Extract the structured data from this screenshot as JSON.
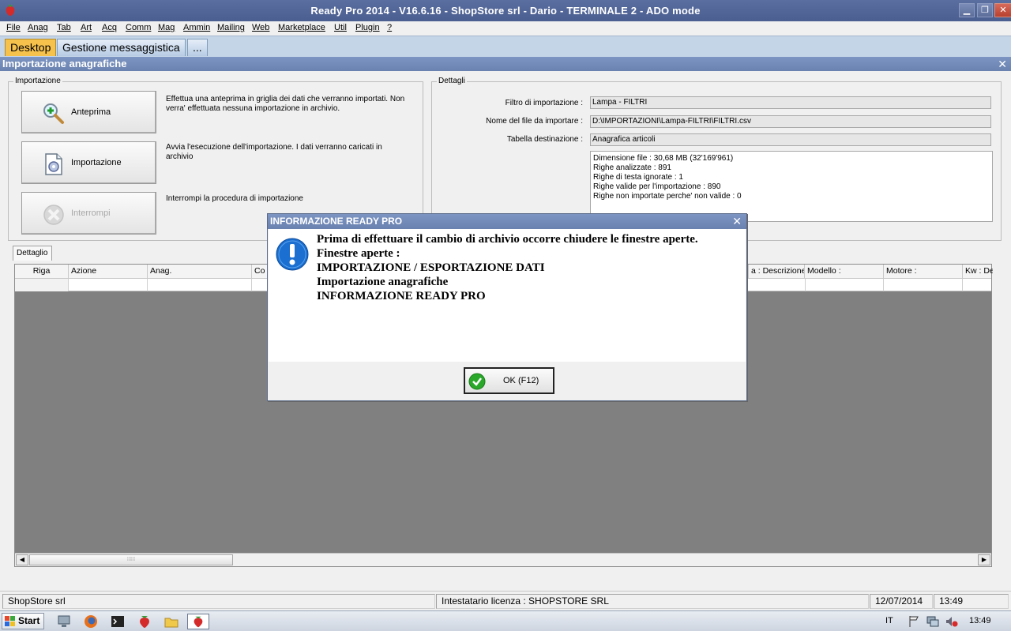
{
  "window": {
    "title": "Ready Pro 2014 - V16.6.16 - ShopStore srl - Dario - TERMINALE 2 - ADO mode",
    "icon": "strawberry-icon"
  },
  "menu": [
    "File",
    "Anag",
    "Tab",
    "Art",
    "Acq",
    "Comm",
    "Mag",
    "Ammin",
    "Mailing",
    "Web",
    "Marketplace",
    "Util",
    "Plugin",
    "?"
  ],
  "tabs": [
    "Desktop",
    "Gestione messaggistica",
    "..."
  ],
  "subwindow": {
    "title": "Importazione anagrafiche"
  },
  "import_group": {
    "legend": "Importazione",
    "buttons": [
      {
        "label": "Anteprima",
        "icon": "magnifier-plus-icon",
        "desc": "Effettua una anteprima in griglia dei dati che verranno importati. Non verra' effettuata nessuna importazione in archivio."
      },
      {
        "label": "Importazione",
        "icon": "document-gear-icon",
        "desc": "Avvia l'esecuzione dell'importazione. I dati verranno caricati in archivio"
      },
      {
        "label": "Interrompi",
        "icon": "stop-x-icon",
        "desc": "Interrompi la procedura di importazione"
      }
    ]
  },
  "details_group": {
    "legend": "Dettagli",
    "filter_label": "Filtro di importazione :",
    "filter_value": "Lampa - FILTRI",
    "file_label": "Nome del file da importare :",
    "file_value": "D:\\IMPORTAZIONI\\Lampa-FILTRI\\FILTRI.csv",
    "table_label": "Tabella destinazione :",
    "table_value": "Anagrafica articoli",
    "info_lines": [
      "Dimensione file : 30,68 MB (32'169'961)",
      "Righe analizzate : 891",
      "Righe di testa ignorate : 1",
      "Righe valide per l'importazione : 890",
      "Righe non importate perche' non valide : 0"
    ]
  },
  "detail_tab": "Dettaglio",
  "grid": {
    "columns_left": [
      "Riga",
      "Azione",
      "Anag.",
      "Co"
    ],
    "columns_right": [
      "a : Descrizione",
      "Modello :",
      "Motore :",
      "Kw : De"
    ]
  },
  "dialog": {
    "title": "INFORMAZIONE READY PRO",
    "message": "Prima di effettuare il cambio di archivio occorre chiudere le finestre aperte.",
    "list_title": "Finestre aperte :",
    "list": [
      "IMPORTAZIONE / ESPORTAZIONE DATI",
      "Importazione anagrafiche",
      "INFORMAZIONE READY PRO"
    ],
    "ok_label": "OK (F12)"
  },
  "status": {
    "company": "ShopStore srl",
    "license": "Intestatario licenza : SHOPSTORE SRL",
    "date": "12/07/2014",
    "time": "13:49"
  },
  "taskbar": {
    "start": "Start",
    "lang": "IT",
    "clock": "13:49"
  }
}
